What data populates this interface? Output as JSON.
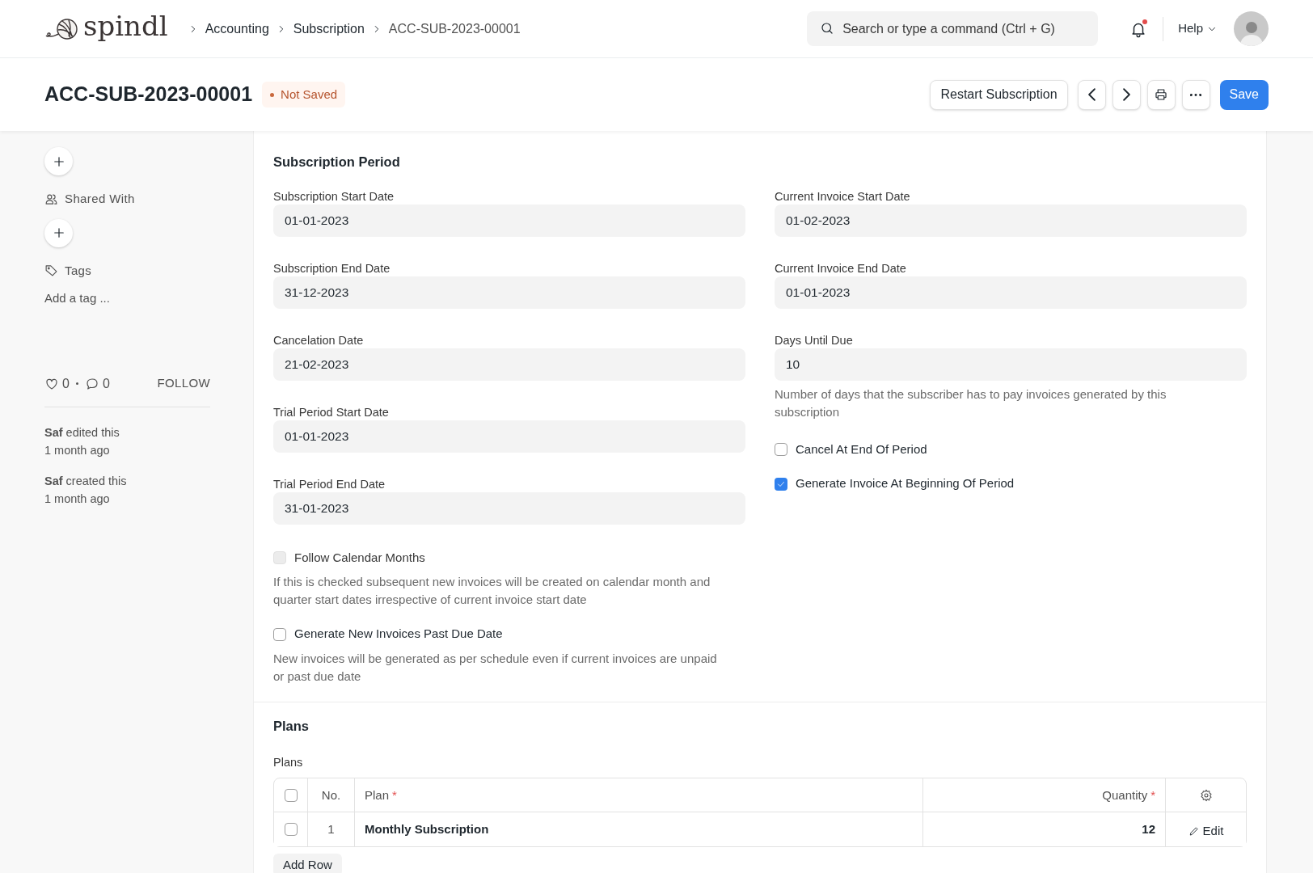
{
  "navbar": {
    "logo": "spindl",
    "breadcrumbs": [
      "Accounting",
      "Subscription",
      "ACC-SUB-2023-00001"
    ],
    "search": {
      "placeholder": "Search or type a command (Ctrl + G)"
    },
    "notifications": {
      "unread": true
    },
    "help": "Help"
  },
  "page_header": {
    "title": "ACC-SUB-2023-00001",
    "status": "Not Saved",
    "buttons": [
      {
        "kind": "text",
        "label": "Restart Subscription"
      },
      {
        "kind": "prev"
      },
      {
        "kind": "next"
      },
      {
        "kind": "print"
      },
      {
        "kind": "more"
      },
      {
        "kind": "primary",
        "label": "Save"
      }
    ]
  },
  "sidebar": {
    "shared_with": "Shared With",
    "tags": "Tags",
    "tag_placeholder": "Add a tag ...",
    "likes": "0",
    "comments": "0",
    "follow": "FOLLOW",
    "activity": [
      {
        "text": "**Saf** edited this",
        "time": "1 month ago"
      },
      {
        "text": "**Saf** created this",
        "time": "1 month ago"
      }
    ]
  },
  "subscription_period": {
    "title": "Subscription Period",
    "left": [
      {
        "kind": "field",
        "label": "Subscription Start Date",
        "value": "01-01-2023"
      },
      {
        "kind": "field",
        "label": "Subscription End Date",
        "value": "31-12-2023"
      },
      {
        "kind": "field",
        "label": "Cancelation Date",
        "value": "21-02-2023"
      },
      {
        "kind": "field",
        "label": "Trial Period Start Date",
        "value": "01-01-2023"
      },
      {
        "kind": "field",
        "label": "Trial Period End Date",
        "value": "31-01-2023"
      },
      {
        "kind": "check",
        "label": "Follow Calendar Months",
        "checked": false,
        "disabled": true,
        "description": "If this is checked subsequent new invoices will be created on calendar month and quarter start dates irrespective of current invoice start date"
      },
      {
        "kind": "check",
        "label": "Generate New Invoices Past Due Date",
        "checked": false,
        "disabled": false,
        "description": "New invoices will be generated as per schedule even if current invoices are unpaid or past due date"
      }
    ],
    "right": [
      {
        "kind": "field",
        "label": "Current Invoice Start Date",
        "value": "01-02-2023"
      },
      {
        "kind": "field",
        "label": "Current Invoice End Date",
        "value": "01-01-2023"
      },
      {
        "kind": "field",
        "label": "Days Until Due",
        "value": "10",
        "description": "Number of days that the subscriber has to pay invoices generated by this subscription"
      },
      {
        "kind": "check",
        "label": "Cancel At End Of Period",
        "checked": false,
        "disabled": false
      },
      {
        "kind": "check",
        "label": "Generate Invoice At Beginning Of Period",
        "checked": true,
        "disabled": false
      }
    ]
  },
  "plans": {
    "title": "Plans",
    "table_label": "Plans",
    "columns": [
      {
        "label": "No.",
        "required": false
      },
      {
        "label": "Plan",
        "required": true,
        "mark": "*"
      },
      {
        "label": "Quantity",
        "required": true,
        "mark": "*"
      }
    ],
    "all_selected": false,
    "rows": [
      {
        "selected": false,
        "no": "1",
        "plan": "Monthly Subscription",
        "quantity": "12",
        "action": "Edit"
      }
    ],
    "add_row": "Add Row"
  }
}
